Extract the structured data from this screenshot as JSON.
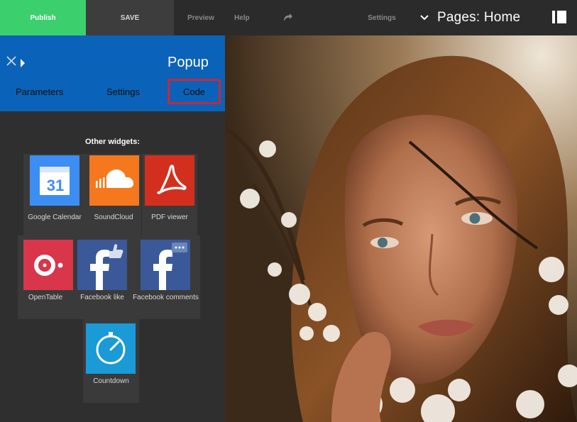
{
  "topbar": {
    "publish_label": "Publish",
    "save_label": "SAVE",
    "preview_label": "Preview",
    "help_label": "Help",
    "settings_label": "Settings",
    "pages_label": "Pages: Home",
    "colors": {
      "publish": "#3ccf6d",
      "save": "#3d3d3d",
      "bar": "#2b2b2b"
    }
  },
  "panel": {
    "title": "Popup",
    "tabs": [
      "Parameters",
      "Settings",
      "Code"
    ],
    "active_tab": "Code",
    "colors": {
      "header": "#0a63b8",
      "highlight": "#c8283a",
      "body": "#2f2f2f"
    },
    "other_widgets_title": "Other widgets:",
    "widgets": [
      {
        "label": "PDF viewer",
        "icon": "pdf-icon",
        "color": "#d32f1e"
      },
      {
        "label": "SoundCloud",
        "icon": "soundcloud-icon",
        "color": "#f5781e"
      },
      {
        "label": "Google Calendar",
        "icon": "calendar-icon",
        "color": "#3d8ef2"
      },
      {
        "label": "Facebook comments",
        "icon": "facebook-icon",
        "color": "#3b5998"
      },
      {
        "label": "Facebook like",
        "icon": "facebook-like-icon",
        "color": "#3b5998"
      },
      {
        "label": "OpenTable",
        "icon": "opentable-icon",
        "color": "#d9354b"
      },
      {
        "label": "Countdown",
        "icon": "stopwatch-icon",
        "color": "#1a9ad6"
      }
    ]
  },
  "canvas": {
    "image": "portrait-photo"
  }
}
